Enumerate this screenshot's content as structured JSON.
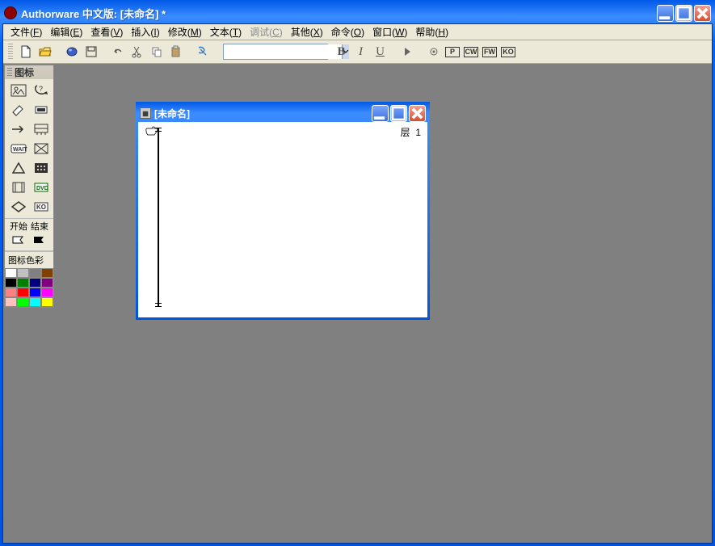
{
  "title": "Authorware 中文版: [未命名] *",
  "menus": [
    {
      "label": "文件",
      "key": "F"
    },
    {
      "label": "编辑",
      "key": "E"
    },
    {
      "label": "查看",
      "key": "V"
    },
    {
      "label": "插入",
      "key": "I"
    },
    {
      "label": "修改",
      "key": "M"
    },
    {
      "label": "文本",
      "key": "T"
    },
    {
      "label": "调试",
      "key": "C",
      "disabled": true
    },
    {
      "label": "其他",
      "key": "X"
    },
    {
      "label": "命令",
      "key": "O"
    },
    {
      "label": "窗口",
      "key": "W"
    },
    {
      "label": "帮助",
      "key": "H"
    }
  ],
  "toolbar": {
    "font_value": "",
    "bold": "B",
    "italic": "I",
    "underline": "U",
    "boxes": [
      "P",
      "CW",
      "FW",
      "KO"
    ]
  },
  "palette": {
    "title": "图标",
    "start": "开始",
    "end": "结束",
    "color_title": "图标色彩",
    "colors": [
      "#ffffff",
      "#c0c0c0",
      "#808080",
      "#804000",
      "#000000",
      "#008000",
      "#000080",
      "#800080",
      "#ff8080",
      "#ff0000",
      "#0000ff",
      "#ff00ff",
      "#ffc0c0",
      "#00ff00",
      "#00ffff",
      "#ffff00"
    ]
  },
  "child": {
    "title": "[未命名]",
    "layer_label": "层",
    "layer_num": "1"
  }
}
